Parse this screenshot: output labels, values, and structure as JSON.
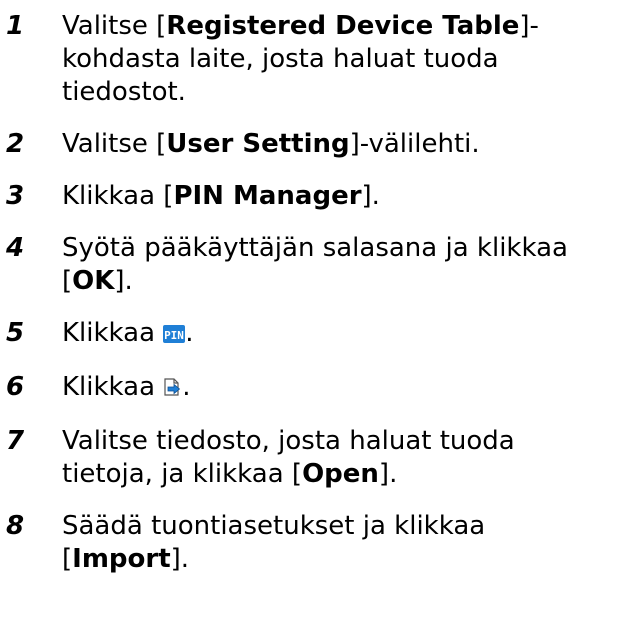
{
  "steps": [
    {
      "number": "1",
      "parts": [
        {
          "type": "text",
          "text": "Valitse ["
        },
        {
          "type": "bold",
          "text": "Registered Device Table"
        },
        {
          "type": "text",
          "text": "]-\nkohdasta laite, josta haluat tuoda\ntiedostot."
        }
      ]
    },
    {
      "number": "2",
      "parts": [
        {
          "type": "text",
          "text": "Valitse ["
        },
        {
          "type": "bold",
          "text": "User Setting"
        },
        {
          "type": "text",
          "text": "]-välilehti."
        }
      ]
    },
    {
      "number": "3",
      "parts": [
        {
          "type": "text",
          "text": "Klikkaa ["
        },
        {
          "type": "bold",
          "text": "PIN Manager"
        },
        {
          "type": "text",
          "text": "]."
        }
      ]
    },
    {
      "number": "4",
      "parts": [
        {
          "type": "text",
          "text": "Syötä pääkäyttäjän salasana ja klikkaa\n["
        },
        {
          "type": "bold",
          "text": "OK"
        },
        {
          "type": "text",
          "text": "]."
        }
      ]
    },
    {
      "number": "5",
      "parts": [
        {
          "type": "text",
          "text": "Klikkaa "
        },
        {
          "type": "icon",
          "icon": "pin-icon",
          "text": "PIN"
        },
        {
          "type": "text",
          "text": "."
        }
      ]
    },
    {
      "number": "6",
      "parts": [
        {
          "type": "text",
          "text": "Klikkaa "
        },
        {
          "type": "icon",
          "icon": "export-icon"
        },
        {
          "type": "text",
          "text": "."
        }
      ]
    },
    {
      "number": "7",
      "parts": [
        {
          "type": "text",
          "text": "Valitse tiedosto, josta haluat tuoda\ntietoja, ja klikkaa ["
        },
        {
          "type": "bold",
          "text": "Open"
        },
        {
          "type": "text",
          "text": "]."
        }
      ]
    },
    {
      "number": "8",
      "parts": [
        {
          "type": "text",
          "text": "Säädä tuontiasetukset ja klikkaa\n["
        },
        {
          "type": "bold",
          "text": "Import"
        },
        {
          "type": "text",
          "text": "]."
        }
      ]
    }
  ],
  "colors": {
    "text": "#000000",
    "pin_icon_bg": "#1f7fd6",
    "pin_icon_text": "#ffffff"
  }
}
